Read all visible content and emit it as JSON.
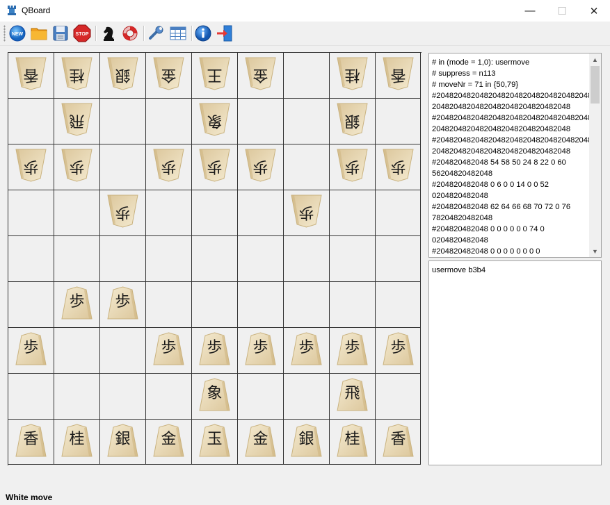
{
  "window": {
    "title": "QBoard",
    "minimize_symbol": "—",
    "maximize_symbol": "☐",
    "close_symbol": "✕"
  },
  "toolbar": {
    "buttons": [
      {
        "name": "new-icon",
        "label": "NEW"
      },
      {
        "name": "open-folder-icon",
        "label": ""
      },
      {
        "name": "save-icon",
        "label": ""
      },
      {
        "name": "stop-icon",
        "label": "STOP"
      },
      {
        "name": "knight-icon",
        "label": ""
      },
      {
        "name": "lifebuoy-icon",
        "label": ""
      },
      {
        "name": "wrench-icon",
        "label": ""
      },
      {
        "name": "grid-table-icon",
        "label": ""
      },
      {
        "name": "info-icon",
        "label": ""
      },
      {
        "name": "exit-icon",
        "label": ""
      }
    ]
  },
  "board": {
    "files": 9,
    "ranks": 9,
    "rows": [
      [
        "香",
        "桂",
        "銀",
        "金",
        "王",
        "金",
        "",
        "桂",
        "香"
      ],
      [
        "",
        "飛",
        "",
        "",
        "象",
        "",
        "",
        "銀",
        ""
      ],
      [
        "歩",
        "歩",
        "",
        "歩",
        "歩",
        "歩",
        "",
        "歩",
        "歩"
      ],
      [
        "",
        "",
        "歩",
        "",
        "",
        "",
        "歩",
        "",
        ""
      ],
      [
        "",
        "",
        "",
        "",
        "",
        "",
        "",
        "",
        ""
      ],
      [
        "",
        "歩",
        "歩",
        "",
        "",
        "",
        "",
        "",
        ""
      ],
      [
        "歩",
        "",
        "",
        "歩",
        "歩",
        "歩",
        "歩",
        "歩",
        "歩"
      ],
      [
        "",
        "",
        "",
        "",
        "象",
        "",
        "",
        "飛",
        ""
      ],
      [
        "香",
        "桂",
        "銀",
        "金",
        "玉",
        "金",
        "銀",
        "桂",
        "香"
      ]
    ],
    "orientation": [
      [
        "down",
        "down",
        "down",
        "down",
        "down",
        "down",
        "",
        "down",
        "down"
      ],
      [
        "",
        "down",
        "",
        "",
        "down",
        "",
        "",
        "down",
        ""
      ],
      [
        "down",
        "down",
        "",
        "down",
        "down",
        "down",
        "",
        "down",
        "down"
      ],
      [
        "",
        "",
        "down",
        "",
        "",
        "",
        "down",
        "",
        ""
      ],
      [
        "",
        "",
        "",
        "",
        "",
        "",
        "",
        "",
        ""
      ],
      [
        "",
        "up",
        "up",
        "",
        "",
        "",
        "",
        "",
        ""
      ],
      [
        "up",
        "",
        "",
        "up",
        "up",
        "up",
        "up",
        "up",
        "up"
      ],
      [
        "",
        "",
        "",
        "",
        "up",
        "",
        "",
        "up",
        ""
      ],
      [
        "up",
        "up",
        "up",
        "up",
        "up",
        "up",
        "up",
        "up",
        "up"
      ]
    ]
  },
  "engine_output": {
    "lines": [
      "# in (mode = 1,0): usermove",
      "# suppress = n113",
      "# moveNr = 71 in {50,79}",
      "#2048204820482048204820482048204820482048",
      "20482048204820482048204820482048",
      "#2048204820482048204820482048204820482048",
      "20482048204820482048204820482048",
      "#2048204820482048204820482048204820482048",
      "20482048204820482048204820482048",
      "#204820482048  54  58  50  24   8  22   0  60",
      "56204820482048",
      "#204820482048   0   6   0   0  14   0   0  52",
      "0204820482048",
      "#204820482048  62  64  66  68  70  72   0  76",
      "78204820482048",
      "#204820482048   0   0   0   0   0   0  74   0",
      "0204820482048",
      "#204820482048   0   0   0   0   0   0   0   0"
    ],
    "scroll_up": "▲",
    "scroll_down": "▼"
  },
  "command_input": {
    "text": "usermove b3b4"
  },
  "status": {
    "text": "White move"
  },
  "colors": {
    "piece_light": "#f4ead0",
    "piece_dark": "#dcc79c",
    "grid": "#333333"
  }
}
